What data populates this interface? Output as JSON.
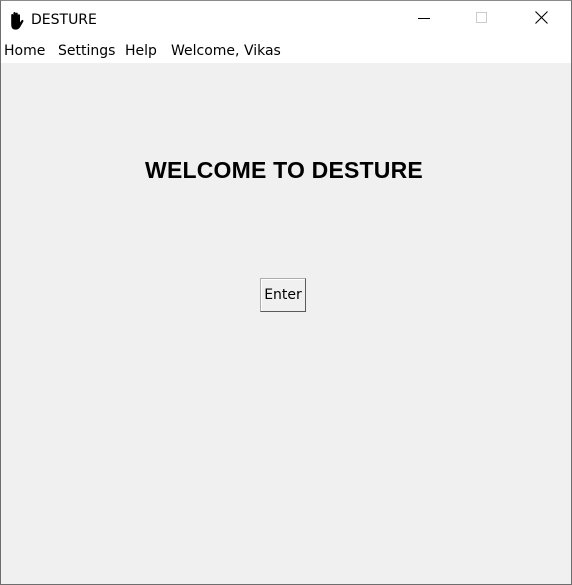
{
  "window": {
    "title": "DESTURE",
    "app_icon": "raised-hand-icon",
    "controls": {
      "minimize": "minimize-icon",
      "maximize": "maximize-icon",
      "close": "close-icon"
    }
  },
  "menubar": {
    "items": [
      {
        "label": "Home"
      },
      {
        "label": "Settings"
      },
      {
        "label": "Help"
      }
    ],
    "welcome_text": "Welcome, Vikas"
  },
  "main": {
    "heading": "WELCOME TO DESTURE",
    "enter_button_label": "Enter"
  },
  "colors": {
    "window_background": "#f0f0f0",
    "titlebar_background": "#ffffff",
    "text": "#000000"
  }
}
